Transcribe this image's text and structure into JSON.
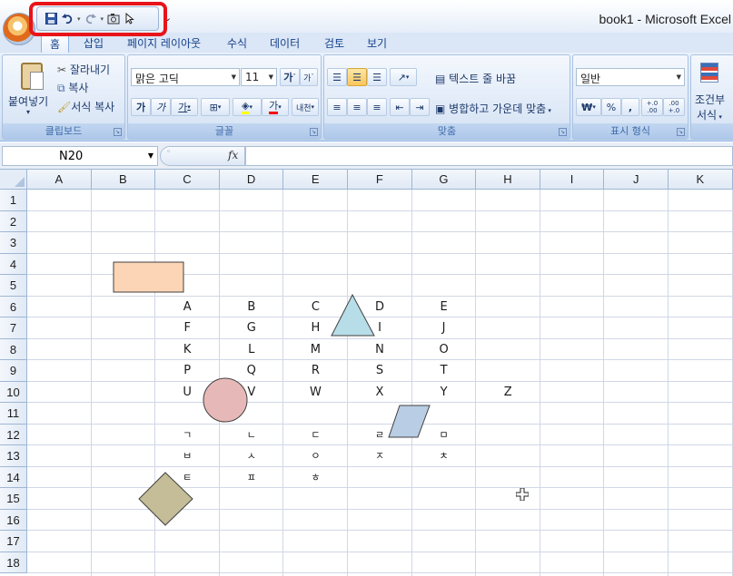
{
  "window": {
    "title": "book1 - Microsoft Excel"
  },
  "quick_access": {
    "icons": [
      "save-icon",
      "undo-icon",
      "redo-icon",
      "camera-icon",
      "select-pointer-icon"
    ]
  },
  "tabs": [
    "홈",
    "삽입",
    "페이지 레이아웃",
    "수식",
    "데이터",
    "검토",
    "보기"
  ],
  "ribbon": {
    "clipboard": {
      "label": "클립보드",
      "paste": "붙여넣기",
      "cut": "잘라내기",
      "copy": "복사",
      "format_painter": "서식 복사"
    },
    "font": {
      "label": "글꼴",
      "font_name": "맑은 고딕",
      "font_size": "11",
      "grow": "가",
      "shrink": "가",
      "bold": "가",
      "italic": "가",
      "underline": "가",
      "font_color_label": "가",
      "phonetic": "내천"
    },
    "alignment": {
      "label": "맞춤",
      "wrap_text": "텍스트 줄 바꿈",
      "merge_center": "병합하고 가운데 맞춤"
    },
    "number": {
      "label": "표시 형식",
      "format": "일반",
      "currency": "₩",
      "percent": "%",
      "comma": ",",
      "inc_decimal": "+.0 .00",
      "dec_decimal": ".00 +.0"
    },
    "styles": {
      "conditional": "조건부",
      "conditional2": "서식"
    }
  },
  "formula_bar": {
    "name_box": "N20",
    "fx": "fx",
    "value": ""
  },
  "sheet": {
    "columns": [
      "A",
      "B",
      "C",
      "D",
      "E",
      "F",
      "G",
      "H",
      "I",
      "J",
      "K"
    ],
    "rows": [
      "1",
      "2",
      "3",
      "4",
      "5",
      "6",
      "7",
      "8",
      "9",
      "10",
      "11",
      "12",
      "13",
      "14",
      "15",
      "16",
      "17",
      "18"
    ],
    "cells": [
      {
        "col": "C",
        "row": 6,
        "value": "A"
      },
      {
        "col": "D",
        "row": 6,
        "value": "B"
      },
      {
        "col": "E",
        "row": 6,
        "value": "C"
      },
      {
        "col": "F",
        "row": 6,
        "value": "D"
      },
      {
        "col": "G",
        "row": 6,
        "value": "E"
      },
      {
        "col": "C",
        "row": 7,
        "value": "F"
      },
      {
        "col": "D",
        "row": 7,
        "value": "G"
      },
      {
        "col": "E",
        "row": 7,
        "value": "H"
      },
      {
        "col": "F",
        "row": 7,
        "value": "I"
      },
      {
        "col": "G",
        "row": 7,
        "value": "J"
      },
      {
        "col": "C",
        "row": 8,
        "value": "K"
      },
      {
        "col": "D",
        "row": 8,
        "value": "L"
      },
      {
        "col": "E",
        "row": 8,
        "value": "M"
      },
      {
        "col": "F",
        "row": 8,
        "value": "N"
      },
      {
        "col": "G",
        "row": 8,
        "value": "O"
      },
      {
        "col": "C",
        "row": 9,
        "value": "P"
      },
      {
        "col": "D",
        "row": 9,
        "value": "Q"
      },
      {
        "col": "E",
        "row": 9,
        "value": "R"
      },
      {
        "col": "F",
        "row": 9,
        "value": "S"
      },
      {
        "col": "G",
        "row": 9,
        "value": "T"
      },
      {
        "col": "C",
        "row": 10,
        "value": "U"
      },
      {
        "col": "D",
        "row": 10,
        "value": "V"
      },
      {
        "col": "E",
        "row": 10,
        "value": "W"
      },
      {
        "col": "F",
        "row": 10,
        "value": "X"
      },
      {
        "col": "G",
        "row": 10,
        "value": "Y"
      },
      {
        "col": "H",
        "row": 10,
        "value": "Z"
      },
      {
        "col": "C",
        "row": 12,
        "value": "ㄱ"
      },
      {
        "col": "D",
        "row": 12,
        "value": "ㄴ"
      },
      {
        "col": "E",
        "row": 12,
        "value": "ㄷ"
      },
      {
        "col": "F",
        "row": 12,
        "value": "ㄹ"
      },
      {
        "col": "G",
        "row": 12,
        "value": "ㅁ"
      },
      {
        "col": "C",
        "row": 13,
        "value": "ㅂ"
      },
      {
        "col": "D",
        "row": 13,
        "value": "ㅅ"
      },
      {
        "col": "E",
        "row": 13,
        "value": "ㅇ"
      },
      {
        "col": "F",
        "row": 13,
        "value": "ㅈ"
      },
      {
        "col": "G",
        "row": 13,
        "value": "ㅊ"
      },
      {
        "col": "C",
        "row": 14,
        "value": "ㅌ"
      },
      {
        "col": "D",
        "row": 14,
        "value": "ㅍ"
      },
      {
        "col": "E",
        "row": 14,
        "value": "ㅎ"
      }
    ],
    "shapes": [
      {
        "type": "rectangle",
        "fill": "#fbd5b5"
      },
      {
        "type": "triangle",
        "fill": "#b7dde8"
      },
      {
        "type": "circle",
        "fill": "#e6b9b8"
      },
      {
        "type": "parallelogram",
        "fill": "#b9cde5"
      },
      {
        "type": "diamond",
        "fill": "#c4bd97"
      }
    ]
  },
  "colors": {
    "highlight": "#e8141a",
    "ribbon": "#dbe7f7"
  }
}
